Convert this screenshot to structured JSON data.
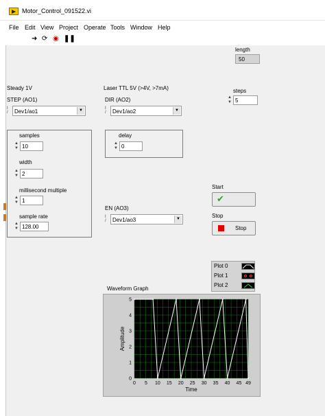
{
  "window": {
    "title": "Motor_Control_091522.vi"
  },
  "menu": [
    "File",
    "Edit",
    "View",
    "Project",
    "Operate",
    "Tools",
    "Window",
    "Help"
  ],
  "toolbar": {
    "icons": [
      "run-arrow-icon",
      "run-continuously-icon",
      "abort-icon",
      "pause-icon"
    ]
  },
  "length": {
    "label": "length",
    "value": "50"
  },
  "steps": {
    "label": "steps",
    "value": "5"
  },
  "step_section": {
    "heading": "Steady 1V",
    "channel_label": "STEP (AO1)",
    "channel_value": "Dev1/ao1"
  },
  "dir_section": {
    "heading": "Laser TTL 5V (>4V, >7mA)",
    "channel_label": "DIR (AO2)",
    "channel_value": "Dev1/ao2"
  },
  "params": {
    "samples_label": "samples",
    "samples_value": "10",
    "width_label": "width",
    "width_value": "2",
    "ms_multiple_label": "millisecond multiple",
    "ms_multiple_value": "1",
    "sample_rate_label": "sample rate",
    "sample_rate_value": "128.00"
  },
  "delay": {
    "label": "delay",
    "value": "0"
  },
  "en_section": {
    "channel_label": "EN (AO3)",
    "channel_value": "Dev1/ao3"
  },
  "start": {
    "label": "Start"
  },
  "stop": {
    "label": "Stop",
    "button_text": "Stop"
  },
  "legend": {
    "items": [
      "Plot 0",
      "Plot 1",
      "Plot 2"
    ]
  },
  "graph": {
    "title": "Waveform Graph"
  },
  "chart_data": {
    "type": "line",
    "title": "Waveform Graph",
    "xlabel": "Time",
    "ylabel": "Amplitude",
    "xlim": [
      0,
      49
    ],
    "ylim": [
      0,
      5
    ],
    "x_ticks": [
      "0",
      "5",
      "10",
      "15",
      "20",
      "25",
      "30",
      "35",
      "40",
      "45",
      "49"
    ],
    "y_ticks": [
      "0",
      "1",
      "2",
      "3",
      "4",
      "5"
    ],
    "grid": true,
    "background": "#000000",
    "grid_color": "#1e7a1e",
    "series": [
      {
        "color": "#ffffff",
        "x": [
          0,
          8,
          10,
          18,
          20,
          28,
          30,
          38,
          40,
          48,
          49
        ],
        "y": [
          5,
          5,
          0,
          5,
          0,
          5,
          0,
          5,
          0,
          5,
          0
        ]
      }
    ]
  }
}
